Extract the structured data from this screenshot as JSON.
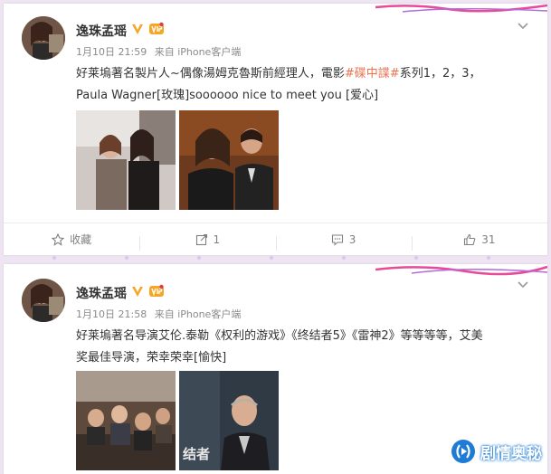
{
  "posts": [
    {
      "user_name": "逸珠孟瑶",
      "time": "1月10日 21:59",
      "source": "来自 iPhone客户端",
      "text_lines": [
        {
          "before": "好莱塢著名製片人~偶像湯姆克魯斯前經理人，電影",
          "tag": "#碟中諜#",
          "after": "系列1，2，3，"
        },
        {
          "before": "Paula Wagner[玫瑰]soooooo nice to meet you [爱心]"
        }
      ],
      "photo_icons": [
        "photo-two-women",
        "photo-paula-and-tom"
      ],
      "actions": {
        "favorite_label": "收藏",
        "repost_count": "1",
        "comment_count": "3",
        "like_count": "31"
      }
    },
    {
      "user_name": "逸珠孟瑶",
      "time": "1月10日 21:58",
      "source": "来自 iPhone客户端",
      "text_lines": [
        {
          "before": "好莱塢著名导演艾伦.泰勒《权利的游戏》《终结者5》《雷神2》等等等等，艾美"
        },
        {
          "before": "奖最佳导演，荣幸荣幸[愉快]"
        }
      ],
      "photo_icons": [
        "photo-group-dinner",
        "photo-alan-taylor"
      ],
      "photo_caption": "结者"
    }
  ],
  "watermark": {
    "text": "剧情奥秘"
  },
  "colors": {
    "accent_tag": "#eb7350",
    "badge_orange": "#f5a623",
    "watermark_blue": "#1e7cd6"
  }
}
